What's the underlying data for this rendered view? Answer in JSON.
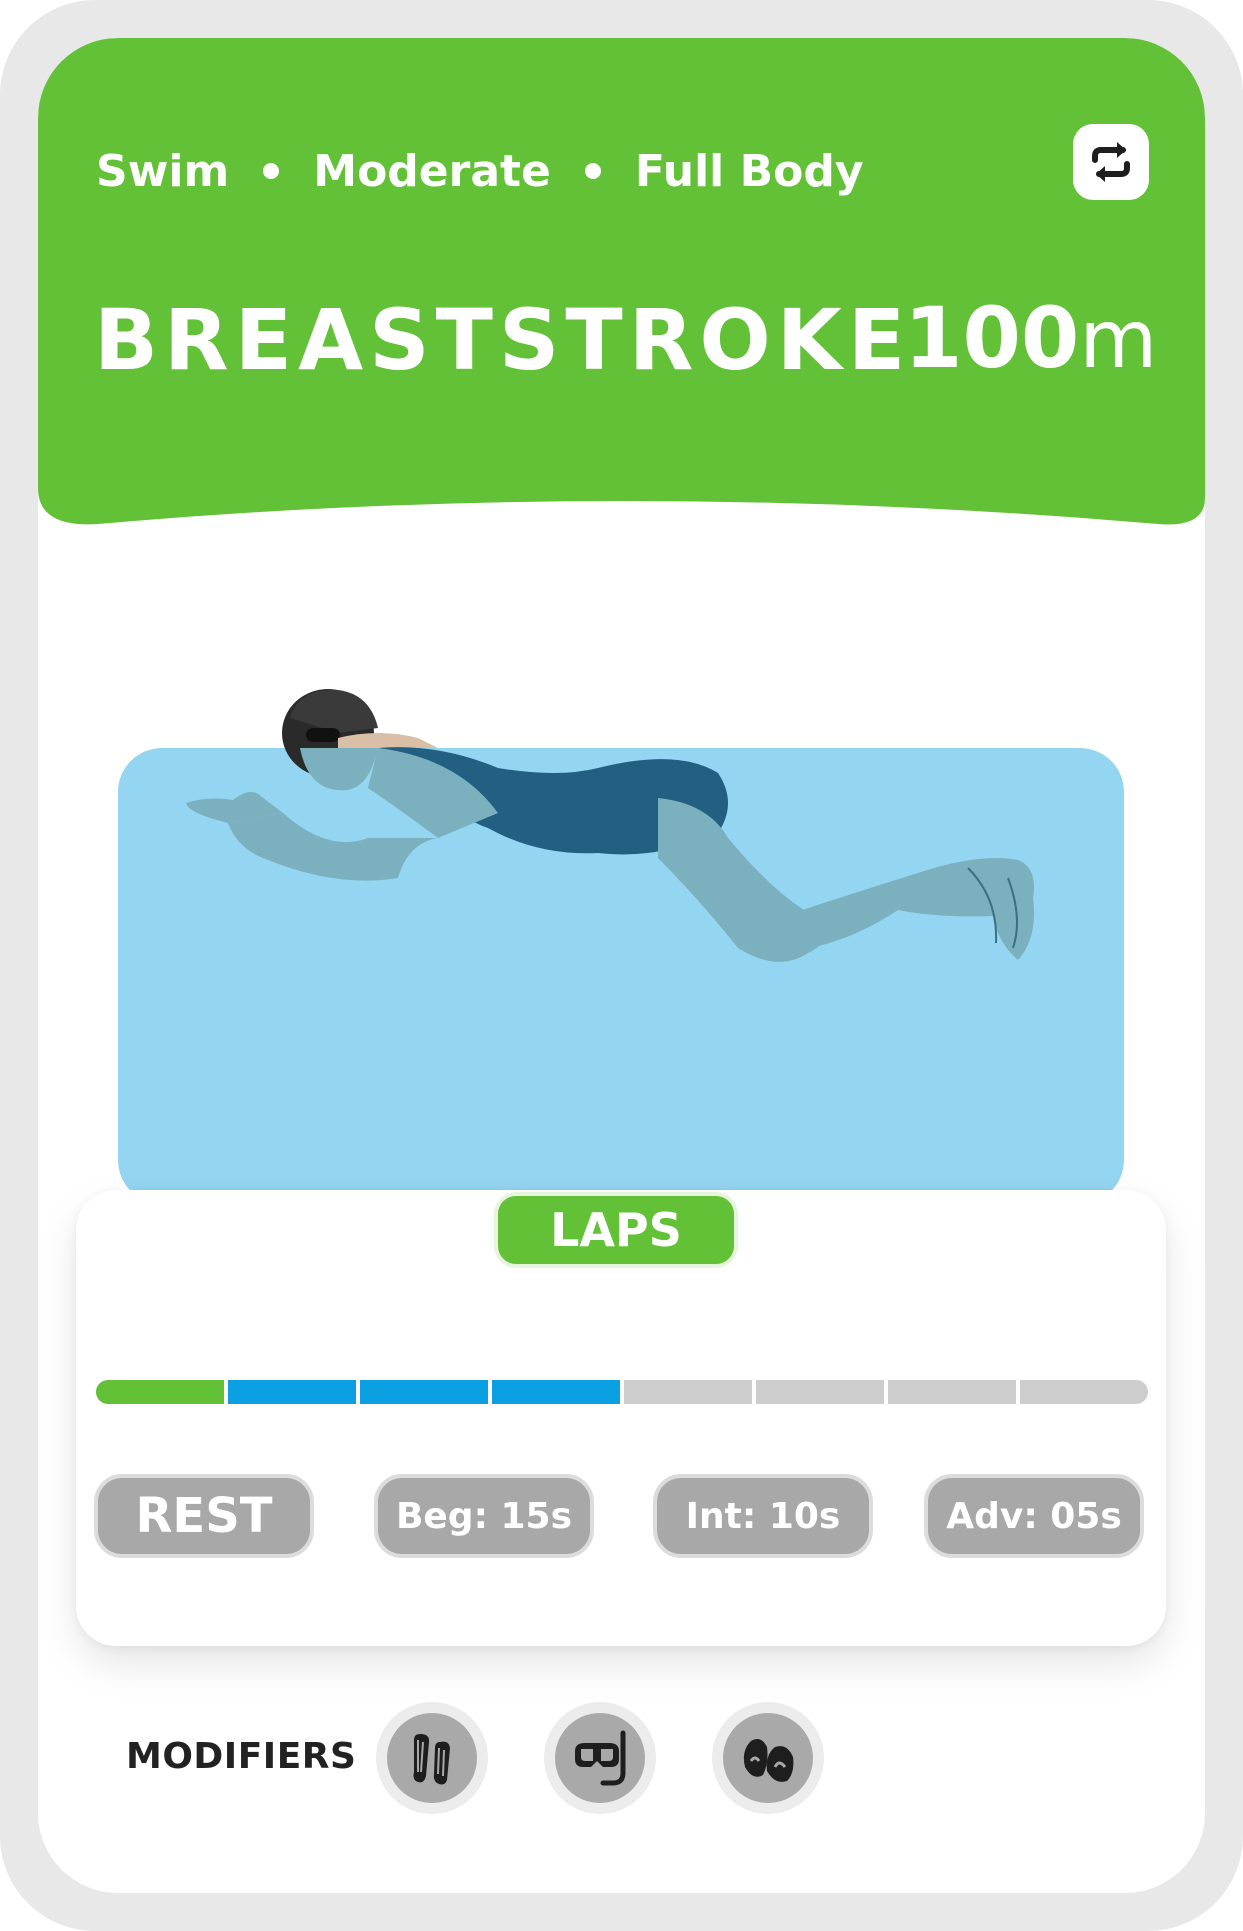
{
  "header": {
    "tags": [
      "Swim",
      "Moderate",
      "Full Body"
    ],
    "title": "BREASTSTROKE",
    "distance_value": "100",
    "distance_unit": "m",
    "repeat_icon": "repeat-icon"
  },
  "laps": {
    "label": "LAPS",
    "completed_segments": 1,
    "active_segments": 3,
    "total_segments": 8,
    "colors": {
      "done": "#62c136",
      "active": "#0aa0e2",
      "todo": "#cdcdcd"
    }
  },
  "rest": {
    "label": "REST",
    "options": [
      "Beg: 15s",
      "Int: 10s",
      "Adv: 05s"
    ]
  },
  "modifiers": {
    "label": "MODIFIERS",
    "separator": ":",
    "items": [
      "fins-icon",
      "snorkel-mask-icon",
      "hand-paddles-icon"
    ]
  },
  "colors": {
    "brand_green": "#62c136",
    "water": "#94d5f1",
    "chip_gray": "#a8a8a8"
  }
}
